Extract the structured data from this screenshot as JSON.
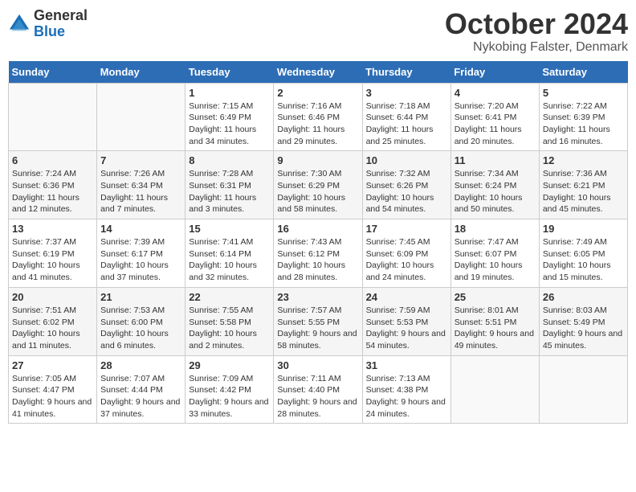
{
  "header": {
    "logo_general": "General",
    "logo_blue": "Blue",
    "month_title": "October 2024",
    "location": "Nykobing Falster, Denmark"
  },
  "days_of_week": [
    "Sunday",
    "Monday",
    "Tuesday",
    "Wednesday",
    "Thursday",
    "Friday",
    "Saturday"
  ],
  "weeks": [
    [
      {
        "num": "",
        "sunrise": "",
        "sunset": "",
        "daylight": "",
        "empty": true
      },
      {
        "num": "",
        "sunrise": "",
        "sunset": "",
        "daylight": "",
        "empty": true
      },
      {
        "num": "1",
        "sunrise": "Sunrise: 7:15 AM",
        "sunset": "Sunset: 6:49 PM",
        "daylight": "Daylight: 11 hours and 34 minutes."
      },
      {
        "num": "2",
        "sunrise": "Sunrise: 7:16 AM",
        "sunset": "Sunset: 6:46 PM",
        "daylight": "Daylight: 11 hours and 29 minutes."
      },
      {
        "num": "3",
        "sunrise": "Sunrise: 7:18 AM",
        "sunset": "Sunset: 6:44 PM",
        "daylight": "Daylight: 11 hours and 25 minutes."
      },
      {
        "num": "4",
        "sunrise": "Sunrise: 7:20 AM",
        "sunset": "Sunset: 6:41 PM",
        "daylight": "Daylight: 11 hours and 20 minutes."
      },
      {
        "num": "5",
        "sunrise": "Sunrise: 7:22 AM",
        "sunset": "Sunset: 6:39 PM",
        "daylight": "Daylight: 11 hours and 16 minutes."
      }
    ],
    [
      {
        "num": "6",
        "sunrise": "Sunrise: 7:24 AM",
        "sunset": "Sunset: 6:36 PM",
        "daylight": "Daylight: 11 hours and 12 minutes."
      },
      {
        "num": "7",
        "sunrise": "Sunrise: 7:26 AM",
        "sunset": "Sunset: 6:34 PM",
        "daylight": "Daylight: 11 hours and 7 minutes."
      },
      {
        "num": "8",
        "sunrise": "Sunrise: 7:28 AM",
        "sunset": "Sunset: 6:31 PM",
        "daylight": "Daylight: 11 hours and 3 minutes."
      },
      {
        "num": "9",
        "sunrise": "Sunrise: 7:30 AM",
        "sunset": "Sunset: 6:29 PM",
        "daylight": "Daylight: 10 hours and 58 minutes."
      },
      {
        "num": "10",
        "sunrise": "Sunrise: 7:32 AM",
        "sunset": "Sunset: 6:26 PM",
        "daylight": "Daylight: 10 hours and 54 minutes."
      },
      {
        "num": "11",
        "sunrise": "Sunrise: 7:34 AM",
        "sunset": "Sunset: 6:24 PM",
        "daylight": "Daylight: 10 hours and 50 minutes."
      },
      {
        "num": "12",
        "sunrise": "Sunrise: 7:36 AM",
        "sunset": "Sunset: 6:21 PM",
        "daylight": "Daylight: 10 hours and 45 minutes."
      }
    ],
    [
      {
        "num": "13",
        "sunrise": "Sunrise: 7:37 AM",
        "sunset": "Sunset: 6:19 PM",
        "daylight": "Daylight: 10 hours and 41 minutes."
      },
      {
        "num": "14",
        "sunrise": "Sunrise: 7:39 AM",
        "sunset": "Sunset: 6:17 PM",
        "daylight": "Daylight: 10 hours and 37 minutes."
      },
      {
        "num": "15",
        "sunrise": "Sunrise: 7:41 AM",
        "sunset": "Sunset: 6:14 PM",
        "daylight": "Daylight: 10 hours and 32 minutes."
      },
      {
        "num": "16",
        "sunrise": "Sunrise: 7:43 AM",
        "sunset": "Sunset: 6:12 PM",
        "daylight": "Daylight: 10 hours and 28 minutes."
      },
      {
        "num": "17",
        "sunrise": "Sunrise: 7:45 AM",
        "sunset": "Sunset: 6:09 PM",
        "daylight": "Daylight: 10 hours and 24 minutes."
      },
      {
        "num": "18",
        "sunrise": "Sunrise: 7:47 AM",
        "sunset": "Sunset: 6:07 PM",
        "daylight": "Daylight: 10 hours and 19 minutes."
      },
      {
        "num": "19",
        "sunrise": "Sunrise: 7:49 AM",
        "sunset": "Sunset: 6:05 PM",
        "daylight": "Daylight: 10 hours and 15 minutes."
      }
    ],
    [
      {
        "num": "20",
        "sunrise": "Sunrise: 7:51 AM",
        "sunset": "Sunset: 6:02 PM",
        "daylight": "Daylight: 10 hours and 11 minutes."
      },
      {
        "num": "21",
        "sunrise": "Sunrise: 7:53 AM",
        "sunset": "Sunset: 6:00 PM",
        "daylight": "Daylight: 10 hours and 6 minutes."
      },
      {
        "num": "22",
        "sunrise": "Sunrise: 7:55 AM",
        "sunset": "Sunset: 5:58 PM",
        "daylight": "Daylight: 10 hours and 2 minutes."
      },
      {
        "num": "23",
        "sunrise": "Sunrise: 7:57 AM",
        "sunset": "Sunset: 5:55 PM",
        "daylight": "Daylight: 9 hours and 58 minutes."
      },
      {
        "num": "24",
        "sunrise": "Sunrise: 7:59 AM",
        "sunset": "Sunset: 5:53 PM",
        "daylight": "Daylight: 9 hours and 54 minutes."
      },
      {
        "num": "25",
        "sunrise": "Sunrise: 8:01 AM",
        "sunset": "Sunset: 5:51 PM",
        "daylight": "Daylight: 9 hours and 49 minutes."
      },
      {
        "num": "26",
        "sunrise": "Sunrise: 8:03 AM",
        "sunset": "Sunset: 5:49 PM",
        "daylight": "Daylight: 9 hours and 45 minutes."
      }
    ],
    [
      {
        "num": "27",
        "sunrise": "Sunrise: 7:05 AM",
        "sunset": "Sunset: 4:47 PM",
        "daylight": "Daylight: 9 hours and 41 minutes."
      },
      {
        "num": "28",
        "sunrise": "Sunrise: 7:07 AM",
        "sunset": "Sunset: 4:44 PM",
        "daylight": "Daylight: 9 hours and 37 minutes."
      },
      {
        "num": "29",
        "sunrise": "Sunrise: 7:09 AM",
        "sunset": "Sunset: 4:42 PM",
        "daylight": "Daylight: 9 hours and 33 minutes."
      },
      {
        "num": "30",
        "sunrise": "Sunrise: 7:11 AM",
        "sunset": "Sunset: 4:40 PM",
        "daylight": "Daylight: 9 hours and 28 minutes."
      },
      {
        "num": "31",
        "sunrise": "Sunrise: 7:13 AM",
        "sunset": "Sunset: 4:38 PM",
        "daylight": "Daylight: 9 hours and 24 minutes."
      },
      {
        "num": "",
        "sunrise": "",
        "sunset": "",
        "daylight": "",
        "empty": true
      },
      {
        "num": "",
        "sunrise": "",
        "sunset": "",
        "daylight": "",
        "empty": true
      }
    ]
  ]
}
